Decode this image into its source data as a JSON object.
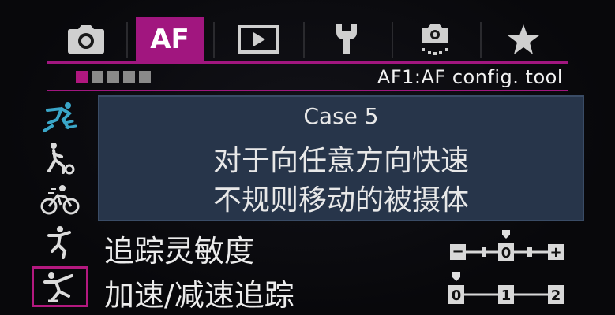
{
  "tabs": [
    {
      "id": "shooting",
      "label": "",
      "icon": "camera-icon"
    },
    {
      "id": "af",
      "label": "AF",
      "icon": "",
      "active": true
    },
    {
      "id": "playback",
      "label": "",
      "icon": "playback-icon"
    },
    {
      "id": "setup",
      "label": "",
      "icon": "wrench-icon"
    },
    {
      "id": "custom",
      "label": "",
      "icon": "custom-function-icon"
    },
    {
      "id": "mymenu",
      "label": "",
      "icon": "star-icon"
    }
  ],
  "page": {
    "indicator_count": 5,
    "active_index": 0,
    "title": "AF1:AF config. tool"
  },
  "cases": [
    {
      "icon": "case1-runner-icon"
    },
    {
      "icon": "case2-runner-icon"
    },
    {
      "icon": "case3-cyclist-icon"
    },
    {
      "icon": "case4-athlete-icon"
    },
    {
      "icon": "case5-skater-icon",
      "selected": true
    }
  ],
  "description": {
    "case": "Case 5",
    "line1": "对于向任意方向快速",
    "line2": "不规则移动的被摄体"
  },
  "params": [
    {
      "label": "追踪灵敏度",
      "ticks": [
        "−",
        "",
        "0",
        "",
        "+"
      ],
      "value_index": 2
    },
    {
      "label": "加速/减速追踪",
      "ticks": [
        "0",
        "1",
        "2"
      ],
      "value_index": 0
    }
  ],
  "colors": {
    "accent": "#a1167f",
    "desc_bg": "#27354a",
    "screen_bg": "#08080a"
  }
}
